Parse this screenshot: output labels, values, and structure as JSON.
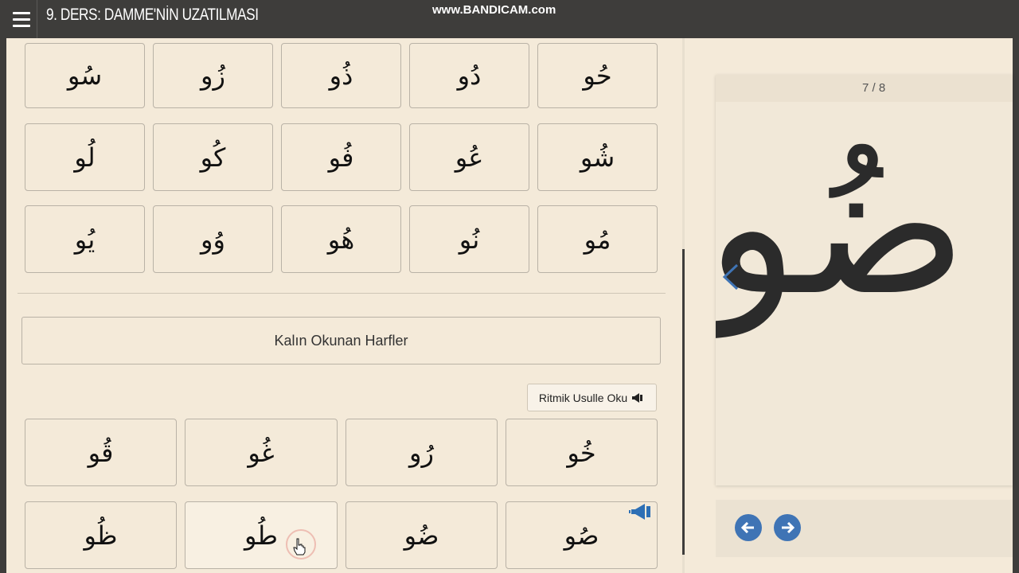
{
  "header": {
    "title": "9. DERS: DAMME'NİN UZATILMASI",
    "watermark": "www.BANDICAM.com"
  },
  "grid_rows": [
    [
      "سُو",
      "زُو",
      "ذُو",
      "دُو",
      "حُو"
    ],
    [
      "لُو",
      "كُو",
      "فُو",
      "عُو",
      "شُو"
    ],
    [
      "يُو",
      "وُو",
      "هُو",
      "نُو",
      "مُو"
    ]
  ],
  "section": {
    "title": "Kalın Okunan Harfler",
    "rhythm_button": "Ritmik Usulle Oku",
    "rows": [
      [
        "قُو",
        "غُو",
        "رُو",
        "خُو"
      ],
      [
        "ظُو",
        "طُو",
        "ضُو",
        "صُو"
      ]
    ]
  },
  "viewer": {
    "page_counter": "7 / 8",
    "current_letter": "ضُو"
  },
  "icons": {
    "menu": "hamburger-icon",
    "speaker": "megaphone-icon",
    "prev": "arrow-left-icon",
    "next": "arrow-right-icon",
    "slide_prev": "chevron-left-icon"
  },
  "colors": {
    "topbar": "#3e3d3b",
    "background": "#f4ead9",
    "accent": "#3f74b5"
  }
}
